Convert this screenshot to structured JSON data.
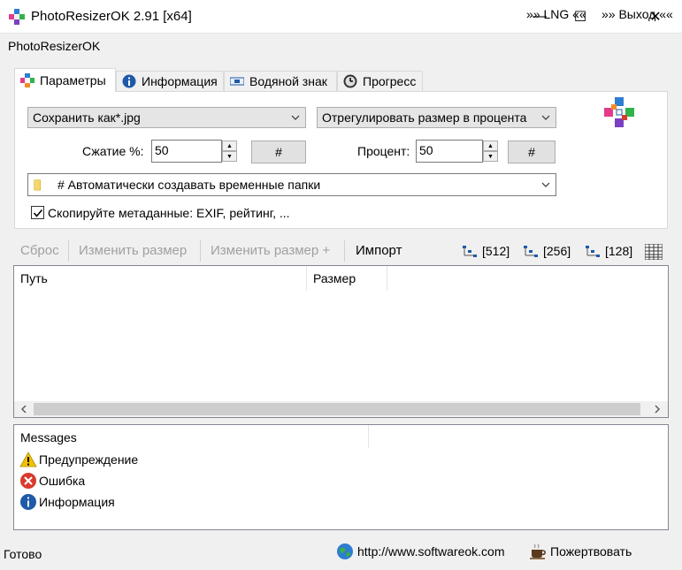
{
  "window": {
    "title": "PhotoResizerOK 2.91 [x64]",
    "minimize_glyph": "—",
    "maximize_glyph": "☐",
    "close_glyph": "✕"
  },
  "menubar": {
    "app_name": "PhotoResizerOK",
    "lng": "»» LNG ««",
    "exit": "»» Выход ««"
  },
  "tabs": [
    {
      "label": "Параметры",
      "icon": "settings-icon",
      "active": true
    },
    {
      "label": "Информация",
      "icon": "info-icon",
      "active": false
    },
    {
      "label": "Водяной знак",
      "icon": "watermark-icon",
      "active": false
    },
    {
      "label": "Прогресс",
      "icon": "clock-icon",
      "active": false
    }
  ],
  "params": {
    "save_as": "Сохранить как*.jpg",
    "resize_mode": "Отрегулировать размер в процента",
    "compression_label": "Сжатие %:",
    "compression_value": "50",
    "compression_hash": "#",
    "percent_label": "Процент:",
    "percent_value": "50",
    "percent_hash": "#",
    "folder_option": "# Автоматически создавать временные папки",
    "copy_metadata_label": "Скопируйте метаданные: EXIF, рейтинг, ...",
    "copy_metadata_checked": true
  },
  "toolbar": {
    "reset": "Сброс",
    "resize": "Изменить размер",
    "resize_plus": "Изменить размер +",
    "import": "Импорт",
    "size_512": "[512]",
    "size_256": "[256]",
    "size_128": "[128]"
  },
  "filelist": {
    "columns": [
      "Путь",
      "Размер"
    ],
    "rows": []
  },
  "messages": {
    "header": "Messages",
    "items": [
      {
        "label": "Предупреждение",
        "icon": "warning-icon"
      },
      {
        "label": "Ошибка",
        "icon": "error-icon"
      },
      {
        "label": "Информация",
        "icon": "info-icon"
      }
    ]
  },
  "statusbar": {
    "status": "Готово",
    "website": "http://www.softwareok.com",
    "donate": "Пожертвовать"
  },
  "colors": {
    "accent_blue": "#1e5aa8",
    "warning_yellow": "#f2c200",
    "error_red": "#d83b2e"
  }
}
